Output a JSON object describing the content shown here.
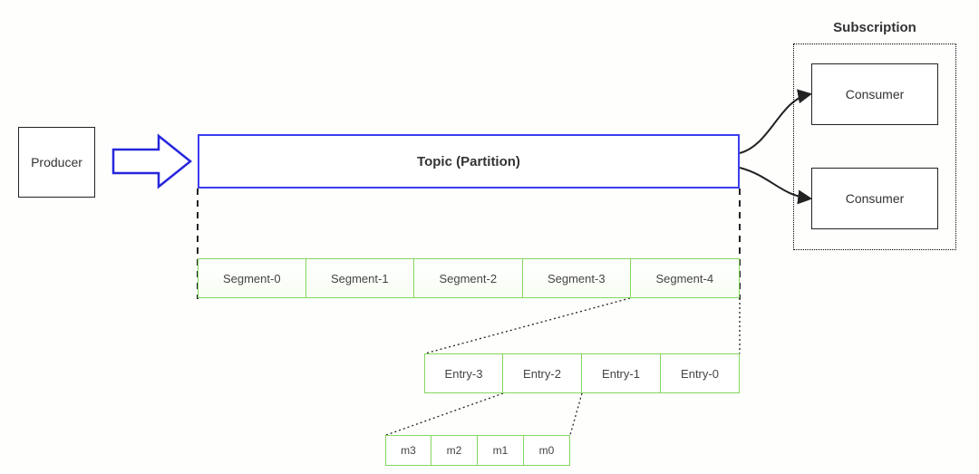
{
  "producer": {
    "label": "Producer"
  },
  "topic": {
    "label": "Topic (Partition)"
  },
  "subscription": {
    "title": "Subscription",
    "consumer1": "Consumer",
    "consumer2": "Consumer"
  },
  "segments": [
    "Segment-0",
    "Segment-1",
    "Segment-2",
    "Segment-3",
    "Segment-4"
  ],
  "entries": [
    "Entry-3",
    "Entry-2",
    "Entry-1",
    "Entry-0"
  ],
  "messages": [
    "m3",
    "m2",
    "m1",
    "m0"
  ]
}
